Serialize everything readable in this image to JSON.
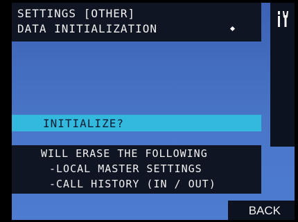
{
  "header": {
    "title": "SETTINGS [OTHER]",
    "subtitle": "DATA INITIALIZATION"
  },
  "side_panel": {
    "icon": "tools-icon"
  },
  "prompt": {
    "text": "INITIALIZE?"
  },
  "info": {
    "lines": [
      "WILL ERASE THE FOLLOWING",
      "-LOCAL MASTER SETTINGS",
      "-CALL HISTORY (IN / OUT)"
    ]
  },
  "footer": {
    "back_label": "BACK"
  },
  "colors": {
    "background": "#4a76c8",
    "panel": "#101524",
    "highlight": "#33b9de",
    "text": "#f2f2f2"
  }
}
